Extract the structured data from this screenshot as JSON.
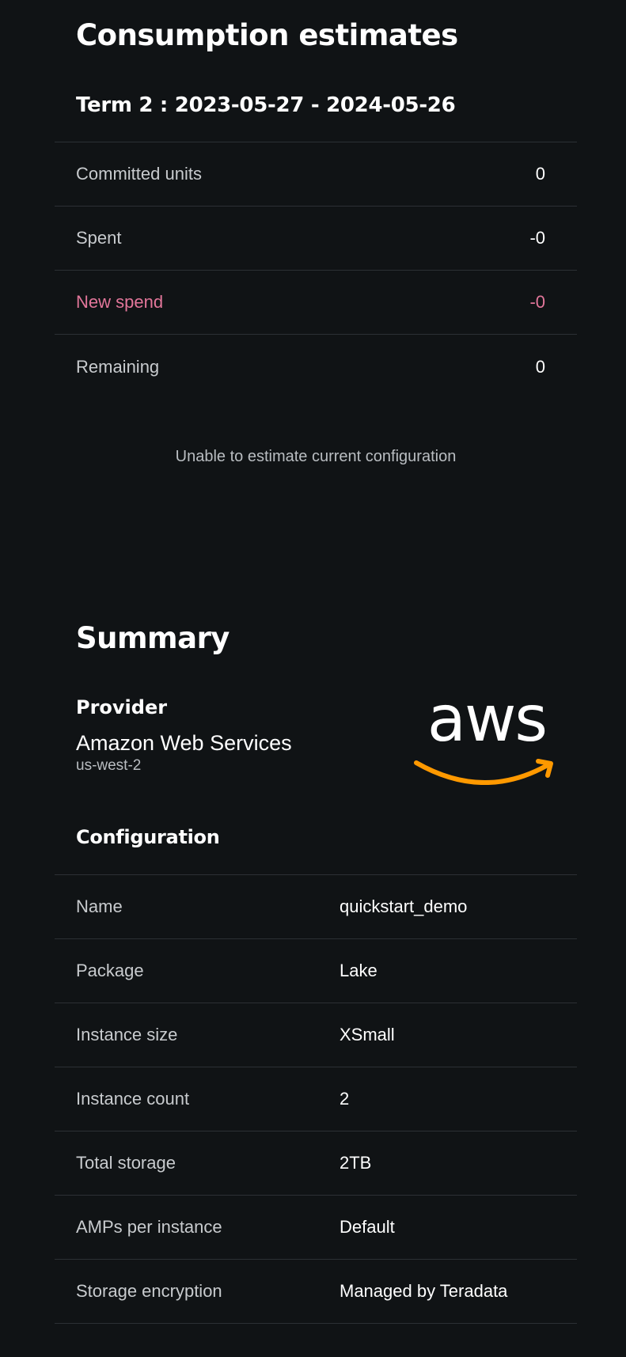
{
  "estimates": {
    "title": "Consumption estimates",
    "term_title": "Term 2 : 2023-05-27 - 2024-05-26",
    "rows": [
      {
        "label": "Committed units",
        "value": "0"
      },
      {
        "label": "Spent",
        "value": "-0"
      },
      {
        "label": "New spend",
        "value": "-0"
      },
      {
        "label": "Remaining",
        "value": "0"
      }
    ],
    "message": "Unable to estimate current configuration",
    "accent_color": "#e2769a"
  },
  "summary": {
    "title": "Summary",
    "provider": {
      "label": "Provider",
      "name": "Amazon Web Services",
      "region": "us-west-2",
      "logo_text": "aws",
      "logo_icon": "aws-logo-icon",
      "logo_smile_color": "#ff9900"
    },
    "configuration": {
      "title": "Configuration",
      "rows": [
        {
          "label": "Name",
          "value": "quickstart_demo"
        },
        {
          "label": "Package",
          "value": "Lake"
        },
        {
          "label": "Instance size",
          "value": "XSmall"
        },
        {
          "label": "Instance count",
          "value": "2"
        },
        {
          "label": "Total storage",
          "value": "2TB"
        },
        {
          "label": "AMPs per instance",
          "value": "Default"
        },
        {
          "label": "Storage encryption",
          "value": "Managed by Teradata"
        }
      ]
    }
  },
  "colors": {
    "background": "#101315",
    "divider": "#2c3034"
  }
}
